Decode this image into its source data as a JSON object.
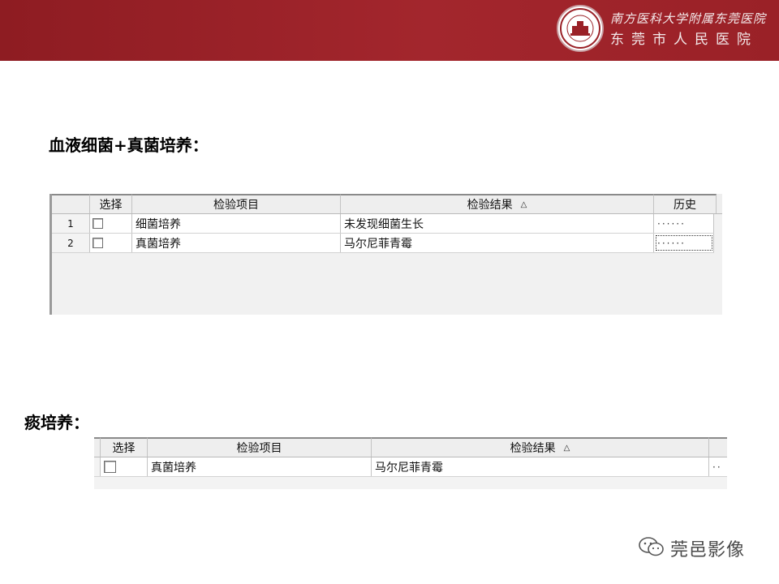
{
  "header": {
    "hospital_line1": "南方医科大学附属东莞医院",
    "hospital_line2": "东莞市人民医院",
    "logo_icon": "hospital-seal-icon",
    "colors": {
      "band": "#9a2127",
      "text": "#f3e9ea"
    }
  },
  "sections": [
    {
      "title": "血液细菌+真菌培养：",
      "table": {
        "columns": [
          "",
          "选择",
          "检验项目",
          "检验结果",
          "历史"
        ],
        "rows": [
          {
            "num": "1",
            "item": "细菌培养",
            "result": "未发现细菌生长",
            "history": "······"
          },
          {
            "num": "2",
            "item": "真菌培养",
            "result": "马尔尼菲青霉",
            "history": "······"
          }
        ]
      }
    },
    {
      "title": "痰培养：",
      "table": {
        "columns": [
          "选择",
          "检验项目",
          "检验结果"
        ],
        "rows": [
          {
            "item": "真菌培养",
            "result": "马尔尼菲青霉",
            "history": "··"
          }
        ]
      }
    }
  ],
  "watermark": {
    "text": "莞邑影像",
    "icon": "wechat-icon"
  }
}
